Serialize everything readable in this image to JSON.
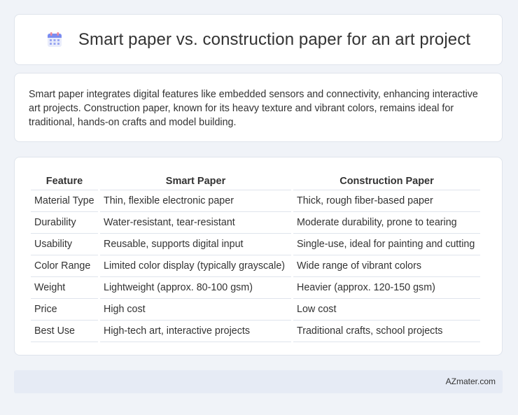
{
  "header": {
    "title": "Smart paper vs. construction paper for an art project",
    "icon": "calendar-icon"
  },
  "summary": "Smart paper integrates digital features like embedded sensors and connectivity, enhancing interactive art projects. Construction paper, known for its heavy texture and vibrant colors, remains ideal for traditional, hands-on crafts and model building.",
  "table": {
    "headers": [
      "Feature",
      "Smart Paper",
      "Construction Paper"
    ],
    "rows": [
      [
        "Material Type",
        "Thin, flexible electronic paper",
        "Thick, rough fiber-based paper"
      ],
      [
        "Durability",
        "Water-resistant, tear-resistant",
        "Moderate durability, prone to tearing"
      ],
      [
        "Usability",
        "Reusable, supports digital input",
        "Single-use, ideal for painting and cutting"
      ],
      [
        "Color Range",
        "Limited color display (typically grayscale)",
        "Wide range of vibrant colors"
      ],
      [
        "Weight",
        "Lightweight (approx. 80-100 gsm)",
        "Heavier (approx. 120-150 gsm)"
      ],
      [
        "Price",
        "High cost",
        "Low cost"
      ],
      [
        "Best Use",
        "High-tech art, interactive projects",
        "Traditional crafts, school projects"
      ]
    ]
  },
  "footer": {
    "site": "AZmater.com"
  },
  "colors": {
    "background": "#f0f3f8",
    "footer": "#e6ebf5",
    "icon_accent": "#6a7ff0"
  }
}
